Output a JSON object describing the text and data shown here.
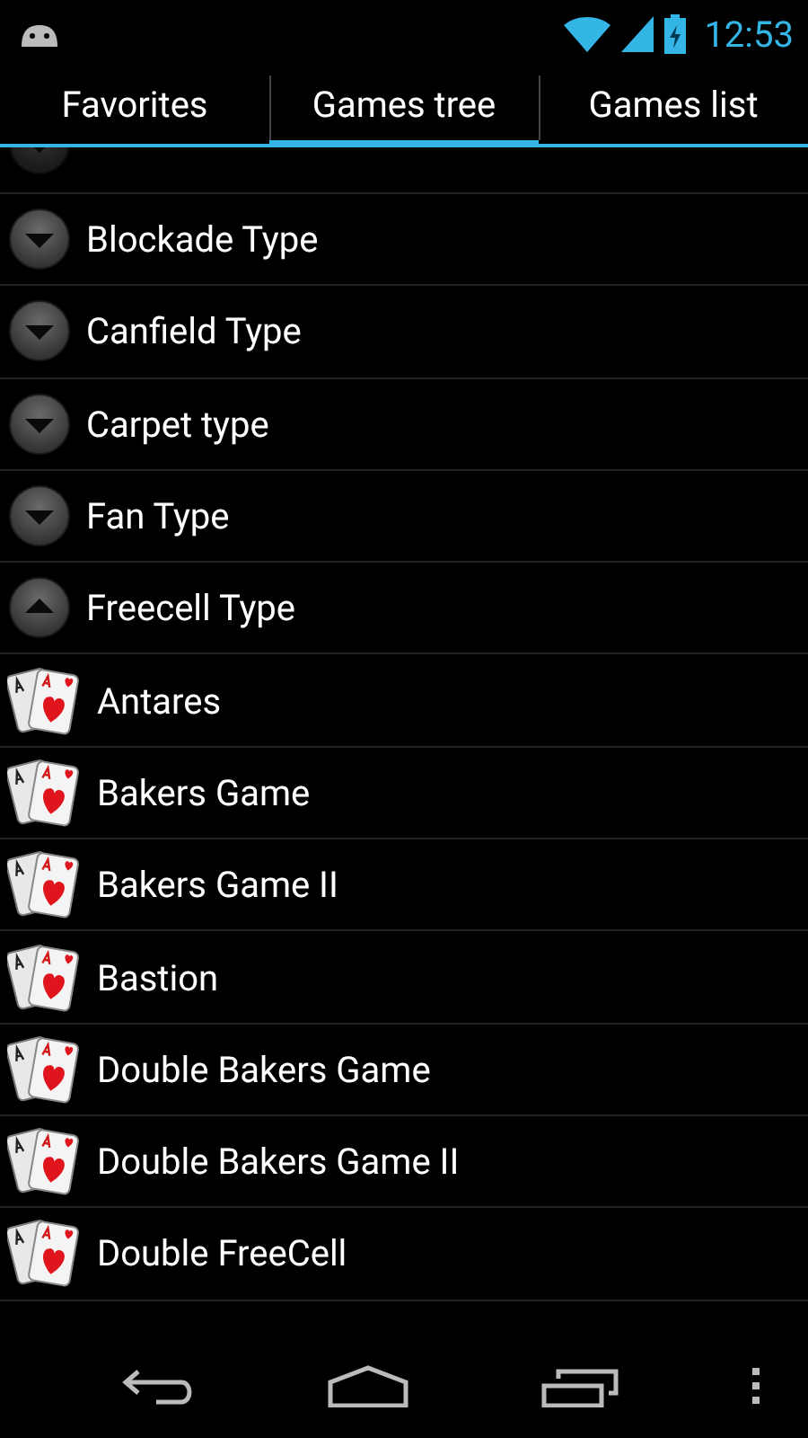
{
  "status_bar": {
    "time": "12:53"
  },
  "tabs": [
    {
      "label": "Favorites",
      "selected": false
    },
    {
      "label": "Games tree",
      "selected": true
    },
    {
      "label": "Games list",
      "selected": false
    }
  ],
  "rows": [
    {
      "kind": "group",
      "label": "Blockade Type",
      "expanded": false
    },
    {
      "kind": "group",
      "label": "Canfield Type",
      "expanded": false
    },
    {
      "kind": "group",
      "label": "Carpet type",
      "expanded": false
    },
    {
      "kind": "group",
      "label": "Fan Type",
      "expanded": false
    },
    {
      "kind": "group",
      "label": "Freecell Type",
      "expanded": true
    },
    {
      "kind": "game",
      "label": "Antares"
    },
    {
      "kind": "game",
      "label": "Bakers Game"
    },
    {
      "kind": "game",
      "label": "Bakers Game II"
    },
    {
      "kind": "game",
      "label": "Bastion"
    },
    {
      "kind": "game",
      "label": "Double Bakers Game"
    },
    {
      "kind": "game",
      "label": "Double Bakers Game II"
    },
    {
      "kind": "game",
      "label": "Double FreeCell"
    }
  ]
}
